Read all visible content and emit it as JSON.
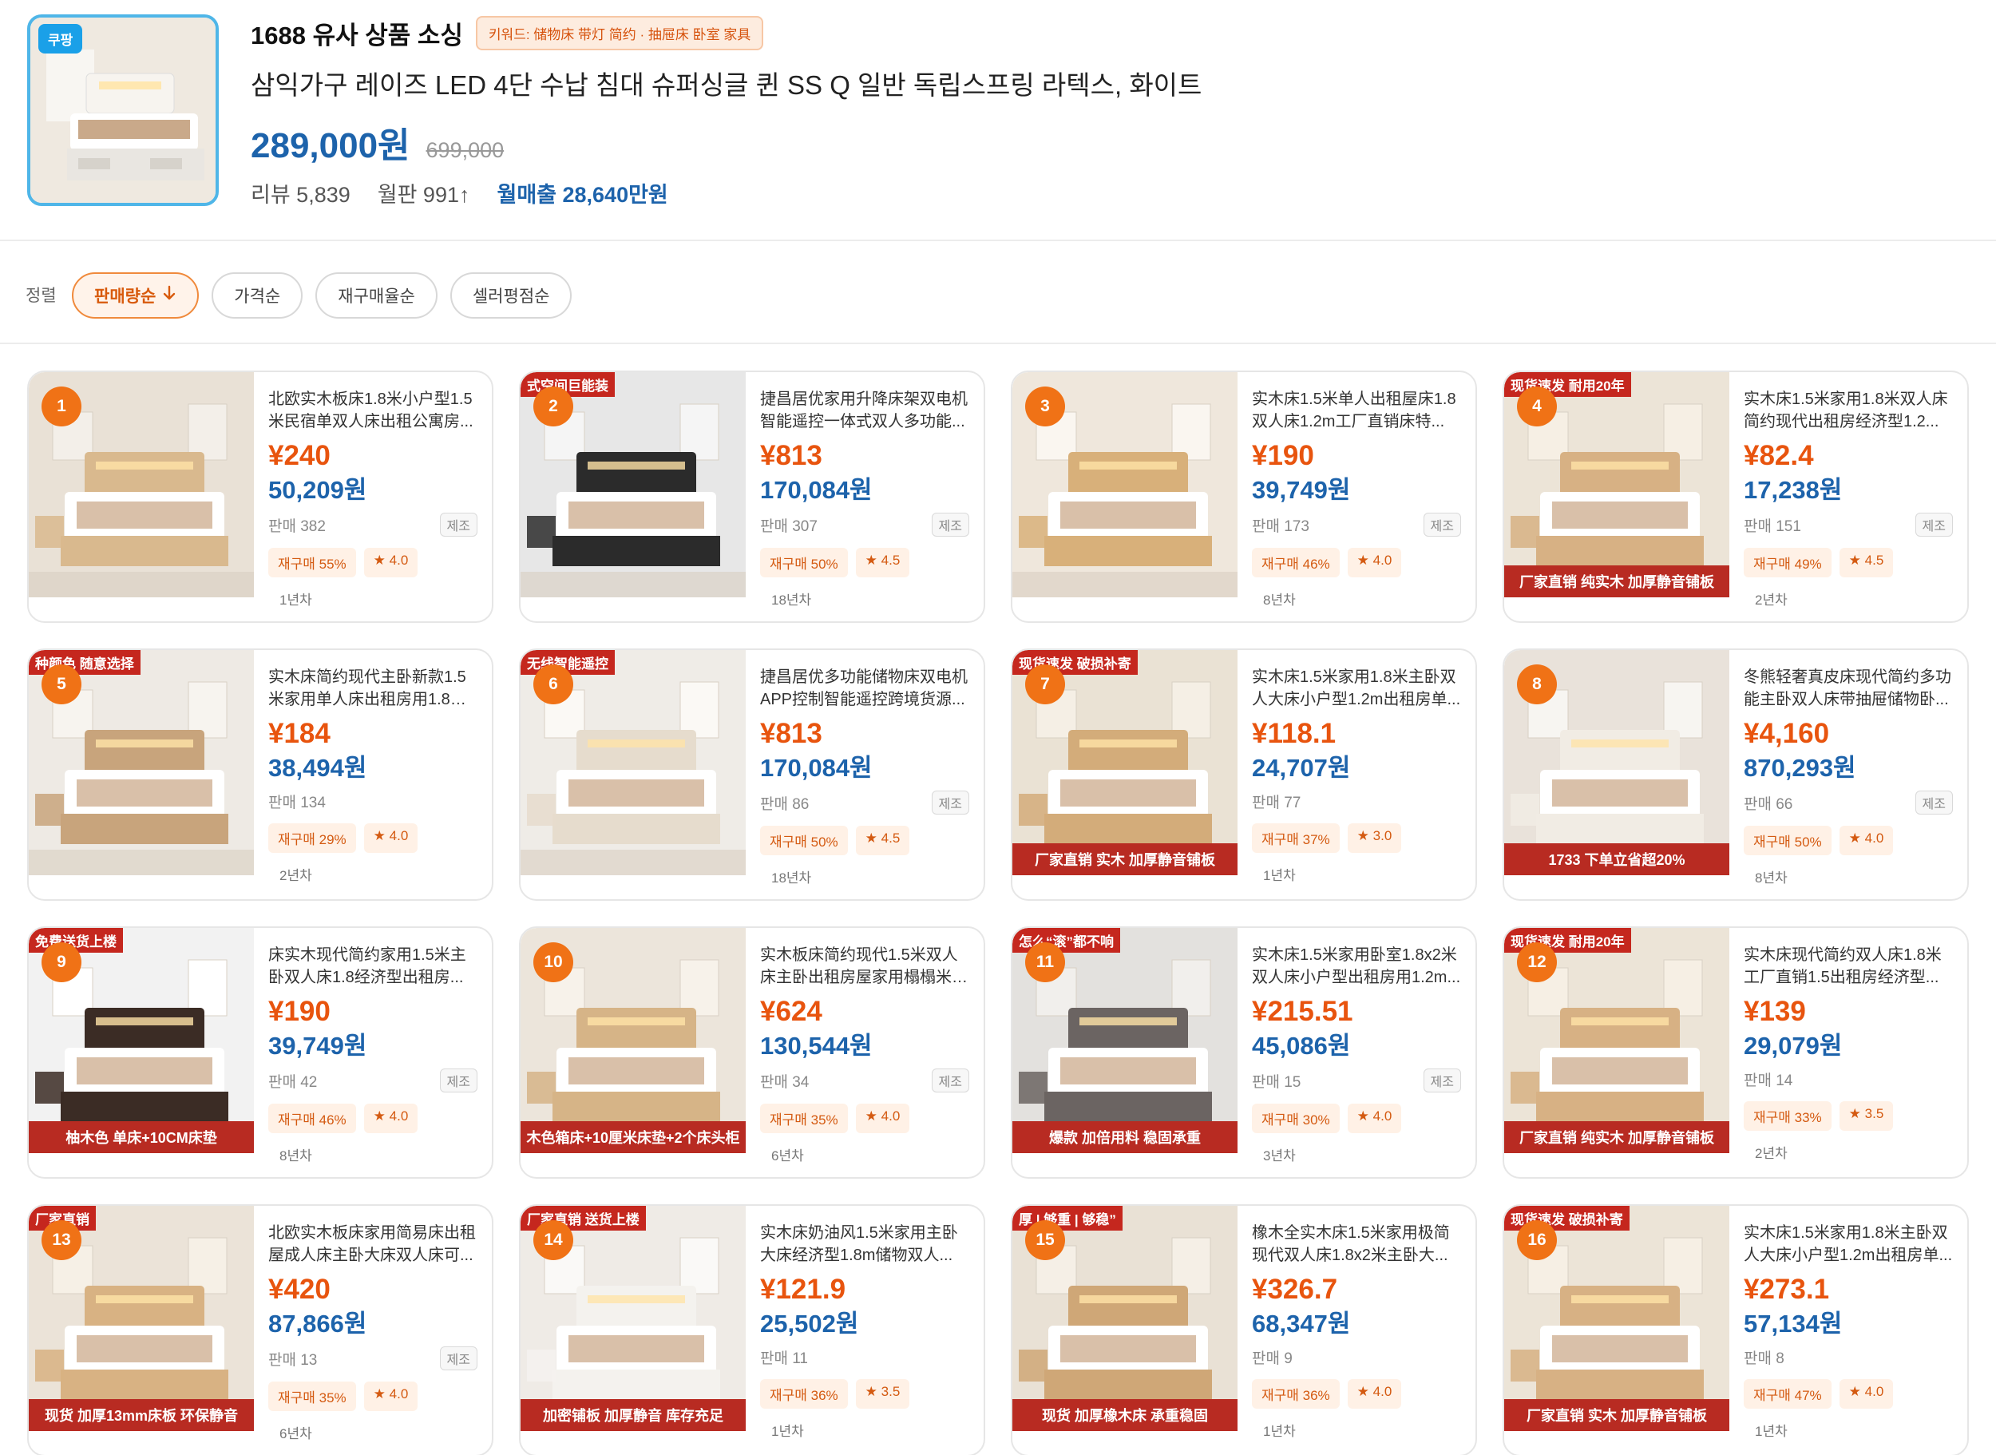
{
  "header": {
    "badge": "쿠팡",
    "title": "1688 유사 상품 소싱",
    "keywords": "키워드: 储物床 带灯 简约 · 抽屉床 卧室 家具",
    "product_name": "삼익가구 레이즈 LED 4단 수납 침대 슈퍼싱글 퀸 SS Q 일반 독립스프링 라텍스, 화이트",
    "price": "289,000원",
    "original_price": "699,000",
    "reviews": "리뷰 5,839",
    "monthly_sales": "월판 991↑",
    "monthly_revenue": "월매출 28,640만원"
  },
  "sort": {
    "label": "정렬",
    "options": [
      "판매량순",
      "가격순",
      "재구매율순",
      "셀러평점순"
    ],
    "active_index": 0,
    "active_arrow": "↓"
  },
  "products": [
    {
      "rank": "1",
      "title": "北欧实木板床1.8米小户型1.5米民宿单双人床出租公寓房...",
      "yuan": "¥240",
      "won": "50,209원",
      "sales": "판매 382",
      "mfg": "제조",
      "repurchase": "재구매 55%",
      "rating": "★ 4.0",
      "years": "1년차",
      "tag": "",
      "banner": ""
    },
    {
      "rank": "2",
      "title": "捷昌居优家用升降床架双电机智能遥控一体式双人多功能...",
      "yuan": "¥813",
      "won": "170,084원",
      "sales": "판매 307",
      "mfg": "제조",
      "repurchase": "재구매 50%",
      "rating": "★ 4.5",
      "years": "18년차",
      "tag": "式空间巨能装",
      "banner": ""
    },
    {
      "rank": "3",
      "title": "实木床1.5米单人出租屋床1.8双人床1.2m工厂直销床特...",
      "yuan": "¥190",
      "won": "39,749원",
      "sales": "판매 173",
      "mfg": "제조",
      "repurchase": "재구매 46%",
      "rating": "★ 4.0",
      "years": "8년차",
      "tag": "",
      "banner": ""
    },
    {
      "rank": "4",
      "title": "实木床1.5米家用1.8米双人床简约现代出租房经济型1.2...",
      "yuan": "¥82.4",
      "won": "17,238원",
      "sales": "판매 151",
      "mfg": "제조",
      "repurchase": "재구매 49%",
      "rating": "★ 4.5",
      "years": "2년차",
      "tag": "现货速发 耐用20年",
      "banner": "厂家直销 纯实木 加厚静音铺板"
    },
    {
      "rank": "5",
      "title": "实木床简约现代主卧新款1.5米家用单人床出租房用1.8储...",
      "yuan": "¥184",
      "won": "38,494원",
      "sales": "판매 134",
      "mfg": "",
      "repurchase": "재구매 29%",
      "rating": "★ 4.0",
      "years": "2년차",
      "tag": "种颜色 随意选择",
      "banner": ""
    },
    {
      "rank": "6",
      "title": "捷昌居优多功能储物床双电机APP控制智能遥控跨境货源...",
      "yuan": "¥813",
      "won": "170,084원",
      "sales": "판매 86",
      "mfg": "제조",
      "repurchase": "재구매 50%",
      "rating": "★ 4.5",
      "years": "18년차",
      "tag": "无线智能遥控",
      "banner": ""
    },
    {
      "rank": "7",
      "title": "实木床1.5米家用1.8米主卧双人大床小户型1.2m出租房单...",
      "yuan": "¥118.1",
      "won": "24,707원",
      "sales": "판매 77",
      "mfg": "",
      "repurchase": "재구매 37%",
      "rating": "★ 3.0",
      "years": "1년차",
      "tag": "现货速发 破损补寄",
      "banner": "厂家直销 实木 加厚静音铺板"
    },
    {
      "rank": "8",
      "title": "冬熊轻奢真皮床现代简约多功能主卧双人床带抽屉储物卧...",
      "yuan": "¥4,160",
      "won": "870,293원",
      "sales": "판매 66",
      "mfg": "제조",
      "repurchase": "재구매 50%",
      "rating": "★ 4.0",
      "years": "8년차",
      "tag": "",
      "banner": "1733 下单立省超20%"
    },
    {
      "rank": "9",
      "title": "床实木现代简约家用1.5米主卧双人床1.8经济型出租房...",
      "yuan": "¥190",
      "won": "39,749원",
      "sales": "판매 42",
      "mfg": "제조",
      "repurchase": "재구매 46%",
      "rating": "★ 4.0",
      "years": "8년차",
      "tag": "免费送货上楼",
      "banner": "柚木色 单床+10CM床垫"
    },
    {
      "rank": "10",
      "title": "实木板床简约现代1.5米双人床主卧出租房屋家用榻榻米1....",
      "yuan": "¥624",
      "won": "130,544원",
      "sales": "판매 34",
      "mfg": "제조",
      "repurchase": "재구매 35%",
      "rating": "★ 4.0",
      "years": "6년차",
      "tag": "",
      "banner": "木色箱床+10厘米床垫+2个床头柜"
    },
    {
      "rank": "11",
      "title": "实木床1.5米家用卧室1.8x2米双人床小户型出租房用1.2m...",
      "yuan": "¥215.51",
      "won": "45,086원",
      "sales": "판매 15",
      "mfg": "제조",
      "repurchase": "재구매 30%",
      "rating": "★ 4.0",
      "years": "3년차",
      "tag": "怎么“滚”都不响",
      "banner": "爆款 加倍用料 稳固承重"
    },
    {
      "rank": "12",
      "title": "实木床现代简约双人床1.8米工厂直销1.5出租房经济型...",
      "yuan": "¥139",
      "won": "29,079원",
      "sales": "판매 14",
      "mfg": "",
      "repurchase": "재구매 33%",
      "rating": "★ 3.5",
      "years": "2년차",
      "tag": "现货速发 耐用20年",
      "banner": "厂家直销 纯实木 加厚静音铺板"
    },
    {
      "rank": "13",
      "title": "北欧实木板床家用简易床出租屋成人床主卧大床双人床可...",
      "yuan": "¥420",
      "won": "87,866원",
      "sales": "판매 13",
      "mfg": "제조",
      "repurchase": "재구매 35%",
      "rating": "★ 4.0",
      "years": "6년차",
      "tag": "厂家直销",
      "banner": "现货 加厚13mm床板 环保静音"
    },
    {
      "rank": "14",
      "title": "实木床奶油风1.5米家用主卧大床经济型1.8m储物双人...",
      "yuan": "¥121.9",
      "won": "25,502원",
      "sales": "판매 11",
      "mfg": "",
      "repurchase": "재구매 36%",
      "rating": "★ 3.5",
      "years": "1년차",
      "tag": "厂家直销 送货上楼",
      "banner": "加密铺板 加厚静音 库存充足"
    },
    {
      "rank": "15",
      "title": "橡木全实木床1.5米家用极简现代双人床1.8x2米主卧大...",
      "yuan": "¥326.7",
      "won": "68,347원",
      "sales": "판매 9",
      "mfg": "",
      "repurchase": "재구매 36%",
      "rating": "★ 4.0",
      "years": "1년차",
      "tag": "厚 | 够重 | 够稳”",
      "banner": "现货 加厚橡木床 承重稳固"
    },
    {
      "rank": "16",
      "title": "实木床1.5米家用1.8米主卧双人大床小户型1.2m出租房单...",
      "yuan": "¥273.1",
      "won": "57,134원",
      "sales": "판매 8",
      "mfg": "",
      "repurchase": "재구매 47%",
      "rating": "★ 4.0",
      "years": "1년차",
      "tag": "现货速发 破损补寄",
      "banner": "厂家直销 实木 加厚静音铺板"
    }
  ],
  "icons": {
    "sort_arrow": "arrow-down-icon"
  },
  "colors": {
    "accent_orange": "#f07216",
    "price_orange": "#e8540e",
    "won_blue": "#1d63ab",
    "thumb_border": "#4fb6e8"
  }
}
